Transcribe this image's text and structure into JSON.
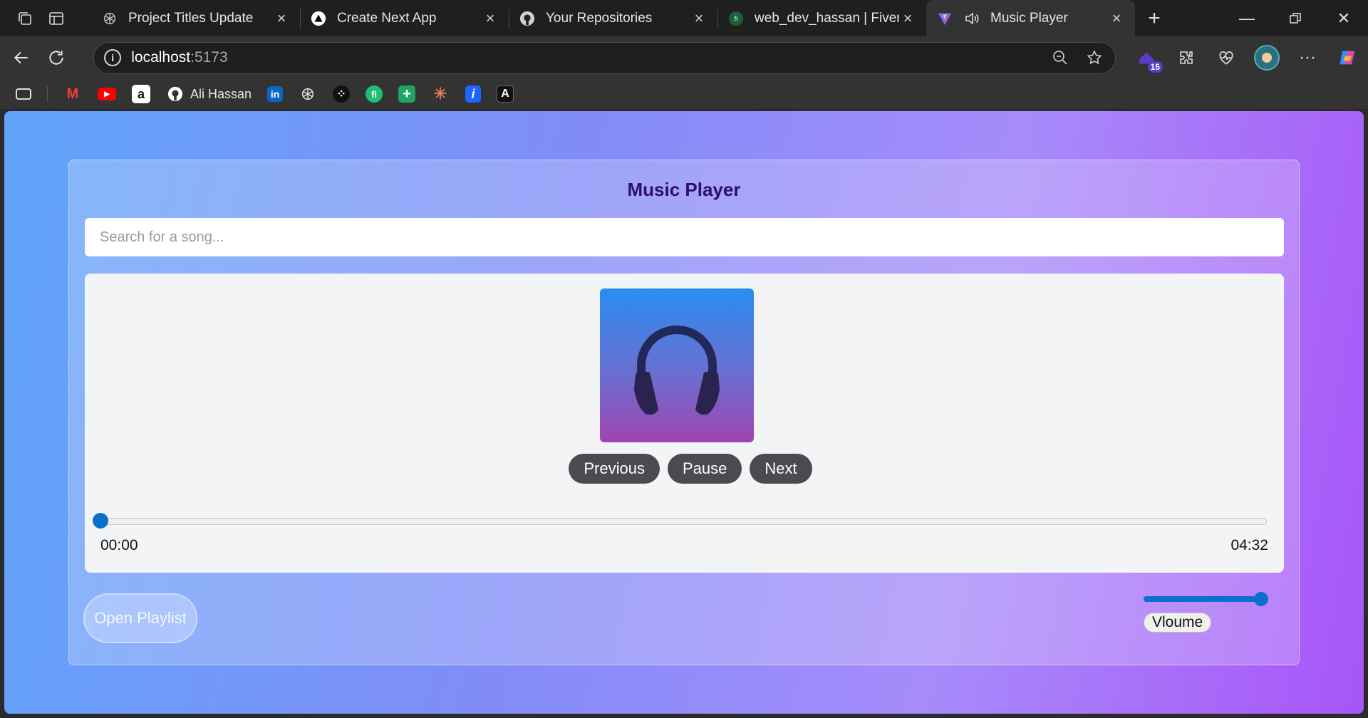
{
  "browser": {
    "tabs": [
      {
        "title": "Project Titles Update",
        "icon": "openai-icon",
        "active": false
      },
      {
        "title": "Create Next App",
        "icon": "triangle-icon",
        "active": false
      },
      {
        "title": "Your Repositories",
        "icon": "github-icon",
        "active": false
      },
      {
        "title": "web_dev_hassan | Fiverr",
        "icon": "fiverr-icon",
        "active": false
      },
      {
        "title": "Music Player",
        "icon": "vite-icon",
        "active": true
      }
    ],
    "address": {
      "host": "localhost",
      "port": ":5173"
    },
    "extension_badge": "15",
    "bookmarks": [
      {
        "label": "",
        "icon": "gmail-icon",
        "color": "#ea4335"
      },
      {
        "label": "",
        "icon": "youtube-icon",
        "color": "#ff0000"
      },
      {
        "label": "",
        "icon": "amazon-icon",
        "color": "#ffffff"
      },
      {
        "label": "Ali Hassan",
        "icon": "github-icon",
        "color": "#ffffff"
      },
      {
        "label": "",
        "icon": "linkedin-icon",
        "color": "#0a66c2"
      },
      {
        "label": "",
        "icon": "openai-icon",
        "color": "#ffffff"
      },
      {
        "label": "",
        "icon": "dots-icon",
        "color": "#111111"
      },
      {
        "label": "",
        "icon": "fiverr-icon",
        "color": "#1dbf73"
      },
      {
        "label": "",
        "icon": "sheets-plus-icon",
        "color": "#1fa463"
      },
      {
        "label": "",
        "icon": "claude-icon",
        "color": "#e07a4f"
      },
      {
        "label": "",
        "icon": "info-i-icon",
        "color": "#1a66ff"
      },
      {
        "label": "",
        "icon": "a-logo-icon",
        "color": "#111111"
      }
    ]
  },
  "app": {
    "title": "Music Player",
    "search_placeholder": "Search for a song...",
    "controls": {
      "previous": "Previous",
      "pause": "Pause",
      "next": "Next"
    },
    "progress": {
      "current": "00:00",
      "total": "04:32",
      "fraction": 0.0
    },
    "open_playlist": "Open Playlist",
    "volume": {
      "label": "Vloume",
      "level": 1.0
    },
    "colors": {
      "title": "#2e1065",
      "accent": "#0a6fcf",
      "button": "#4b4b4f"
    }
  }
}
